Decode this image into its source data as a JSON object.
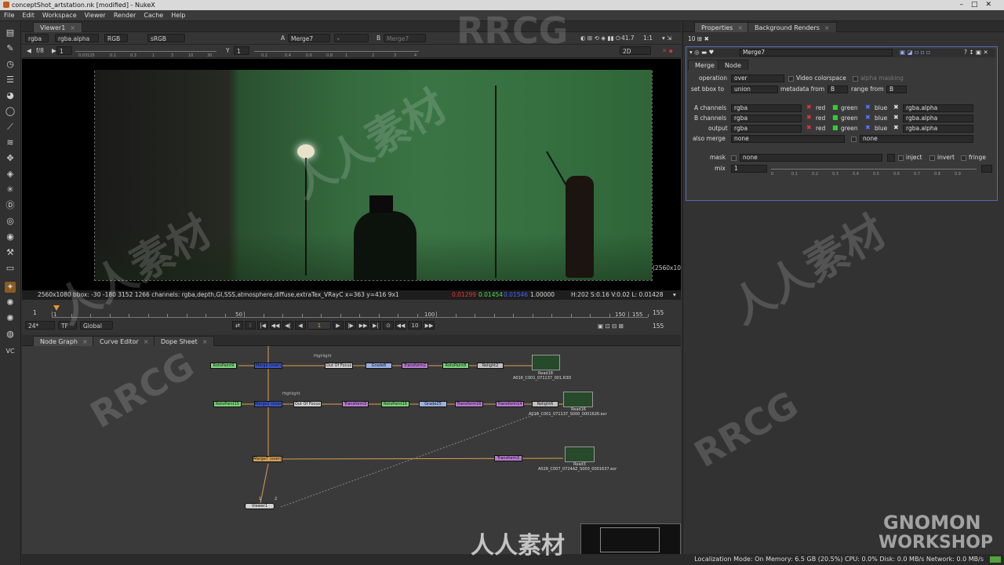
{
  "window": {
    "title": "conceptShot_artstation.nk [modified] - NukeX"
  },
  "menu": [
    "File",
    "Edit",
    "Workspace",
    "Viewer",
    "Render",
    "Cache",
    "Help"
  ],
  "toolbar_icons": [
    "layout-icon",
    "draw-icon",
    "time-icon",
    "channel-icon",
    "color-icon",
    "filter-icon",
    "keyer-icon",
    "merge-icon",
    "transform-icon",
    "3d-icon",
    "particle-icon",
    "deep-icon",
    "views-icon",
    "metadata-icon",
    "toolsets-icon",
    "other-icon",
    "furnace-icon",
    "ocula-icon",
    "cara-icon",
    "lens-icon",
    "mcp-icon",
    "vc-icon"
  ],
  "viewer": {
    "tab": "Viewer1",
    "channels": "rgba",
    "alpha": "rgba.alpha",
    "colorspace_mode": "RGB",
    "lut": "sRGB",
    "input_a_label": "A",
    "input_a": "Merge7",
    "input_b_label": "B",
    "input_b": "Merge7",
    "dash": "-",
    "zoom_value": "41.7",
    "ratio": "1:1",
    "fstop": "f/8",
    "gain": "1",
    "gamma_label": "Y",
    "gamma": "1",
    "mode": "2D",
    "format_label": "(2560x10",
    "info_left": "2560x1080  bbox: -30 -180 3152 1266 channels: rgba,depth,GI,SSS,atmosphere,diffuse,extraTex_VRayC  x=363 y=416 9x1",
    "pixel_r": "0.01299",
    "pixel_g": "0.01454",
    "pixel_b": "0.01546",
    "pixel_a": "1.00000",
    "hsv": "H:202 S:0.16 V:0.02  L: 0.01428",
    "gain_ticks": [
      "0.03125",
      "0.1",
      "0.3",
      "1",
      "3",
      "10",
      "30"
    ],
    "gamma_ticks": [
      "0.2",
      "0.4",
      "0.6",
      "0.8",
      "1",
      "2",
      "3",
      "4"
    ]
  },
  "timeline": {
    "start": "1",
    "end": "155",
    "current": "1",
    "labels": [
      "50",
      "100",
      "150",
      "155"
    ],
    "fps": "24*",
    "tf": "TF",
    "global": "Global",
    "frame_step": "10",
    "out_frame": "155",
    "in_frame": "155"
  },
  "bottom_tabs": [
    "Node Graph",
    "Curve Editor",
    "Dope Sheet"
  ],
  "nodes": {
    "row1": [
      "RotoPaint9",
      "Merge (over)",
      "Out Of Focus",
      "Grade8",
      "Transform2",
      "RotoPaint8",
      "Relight2",
      "Read18"
    ],
    "row1_read_label": "A016_C001_071137_001.R3D",
    "row2": [
      "RotoPaint15",
      "Merge2 (over)",
      "Out Of Focus",
      "Transform3",
      "RotoPaint16",
      "Grade25",
      "Transform16",
      "Transform14",
      "Relight6",
      "Read16"
    ],
    "row2_read_label": "A016_C001_071137_S000_0001626.exr",
    "row3": [
      "Merge7 (over)",
      "Transform3",
      "Read3"
    ],
    "row3_read_label": "A028_C007_0724AZ_S000_0001637.exr",
    "viewer_node": "Viewer1",
    "highlight_label": "Highlight",
    "numbers": [
      "1",
      "2"
    ]
  },
  "properties": {
    "tabs": [
      "Properties",
      "Background Renders"
    ],
    "count": "10",
    "node_name": "Merge7",
    "subtabs": [
      "Merge",
      "Node"
    ],
    "operation_label": "operation",
    "operation": "over",
    "video_colorspace": "Video colorspace",
    "alpha_masking": "alpha masking",
    "bbox_label": "set bbox to",
    "bbox": "union",
    "metadata_label": "metadata from",
    "metadata": "B",
    "range_label": "range from",
    "range": "B",
    "a_channels_label": "A channels",
    "a_channels": "rgba",
    "b_channels_label": "B channels",
    "b_channels": "rgba",
    "output_label": "output",
    "output": "rgba",
    "also_merge_label": "also merge",
    "also_merge": "none",
    "also_merge2": "none",
    "red": "red",
    "green": "green",
    "blue": "blue",
    "alpha_ch": "rgba.alpha",
    "mask_label": "mask",
    "mask": "none",
    "inject": "inject",
    "invert": "invert",
    "fringe": "fringe",
    "mix_label": "mix",
    "mix": "1",
    "mix_ticks": [
      "0",
      "0.1",
      "0.2",
      "0.3",
      "0.4",
      "0.5",
      "0.6",
      "0.7",
      "0.8",
      "0.9"
    ]
  },
  "status": "Localization Mode: On Memory: 6.5 GB (20.5%) CPU: 0.0% Disk: 0.0 MB/s Network: 0.0 MB/s",
  "watermarks": {
    "rrcg": "RRCG",
    "cn": "人人素材",
    "gnomon1": "GNOMON",
    "gnomon2": "WORKSHOP"
  },
  "colors": {
    "accent_blue": "#4f6fb0",
    "green_screen": "#3a7444",
    "status_green": "#53a33a"
  }
}
